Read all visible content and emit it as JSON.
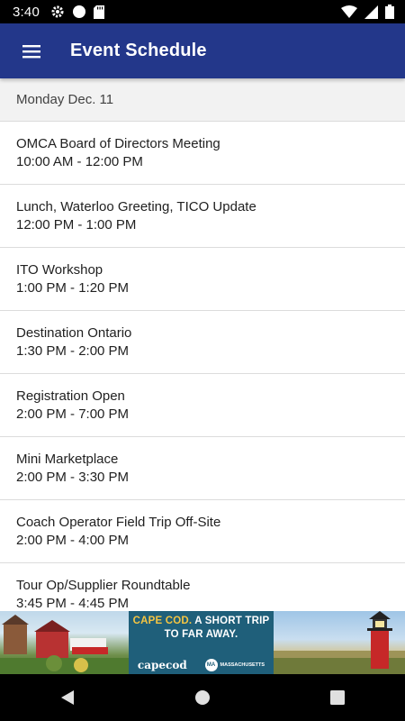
{
  "status_bar": {
    "time": "3:40",
    "left_icons": [
      "gear-icon",
      "circle-icon",
      "sd-card-icon"
    ],
    "right_icons": [
      "wifi-icon",
      "signal-icon",
      "battery-icon"
    ]
  },
  "app_bar": {
    "title": "Event Schedule",
    "menu_icon": "hamburger-menu-icon",
    "color": "#23378a"
  },
  "schedule": {
    "day_label": "Monday Dec. 11",
    "events": [
      {
        "title": "OMCA Board of Directors Meeting",
        "time": "10:00 AM - 12:00 PM"
      },
      {
        "title": "Lunch, Waterloo Greeting, TICO Update",
        "time": "12:00 PM - 1:00 PM"
      },
      {
        "title": "ITO Workshop",
        "time": "1:00 PM - 1:20 PM"
      },
      {
        "title": "Destination Ontario",
        "time": "1:30 PM - 2:00 PM"
      },
      {
        "title": "Registration Open",
        "time": "2:00 PM - 7:00 PM"
      },
      {
        "title": "Mini Marketplace",
        "time": "2:00 PM - 3:30 PM"
      },
      {
        "title": "Coach Operator Field Trip Off-Site",
        "time": "2:00 PM - 4:00 PM"
      },
      {
        "title": "Tour Op/Supplier Roundtable",
        "time": "3:45 PM - 4:45 PM"
      }
    ]
  },
  "ad": {
    "headline_highlight": "CAPE COD.",
    "headline_rest": " A SHORT TRIP TO FAR AWAY.",
    "logo_left": "capecod",
    "logo_right_badge": "MA",
    "logo_right_text": "MASSACHUSETTS"
  },
  "nav_bar": {
    "buttons": [
      "back-icon",
      "home-icon",
      "recents-icon"
    ]
  }
}
